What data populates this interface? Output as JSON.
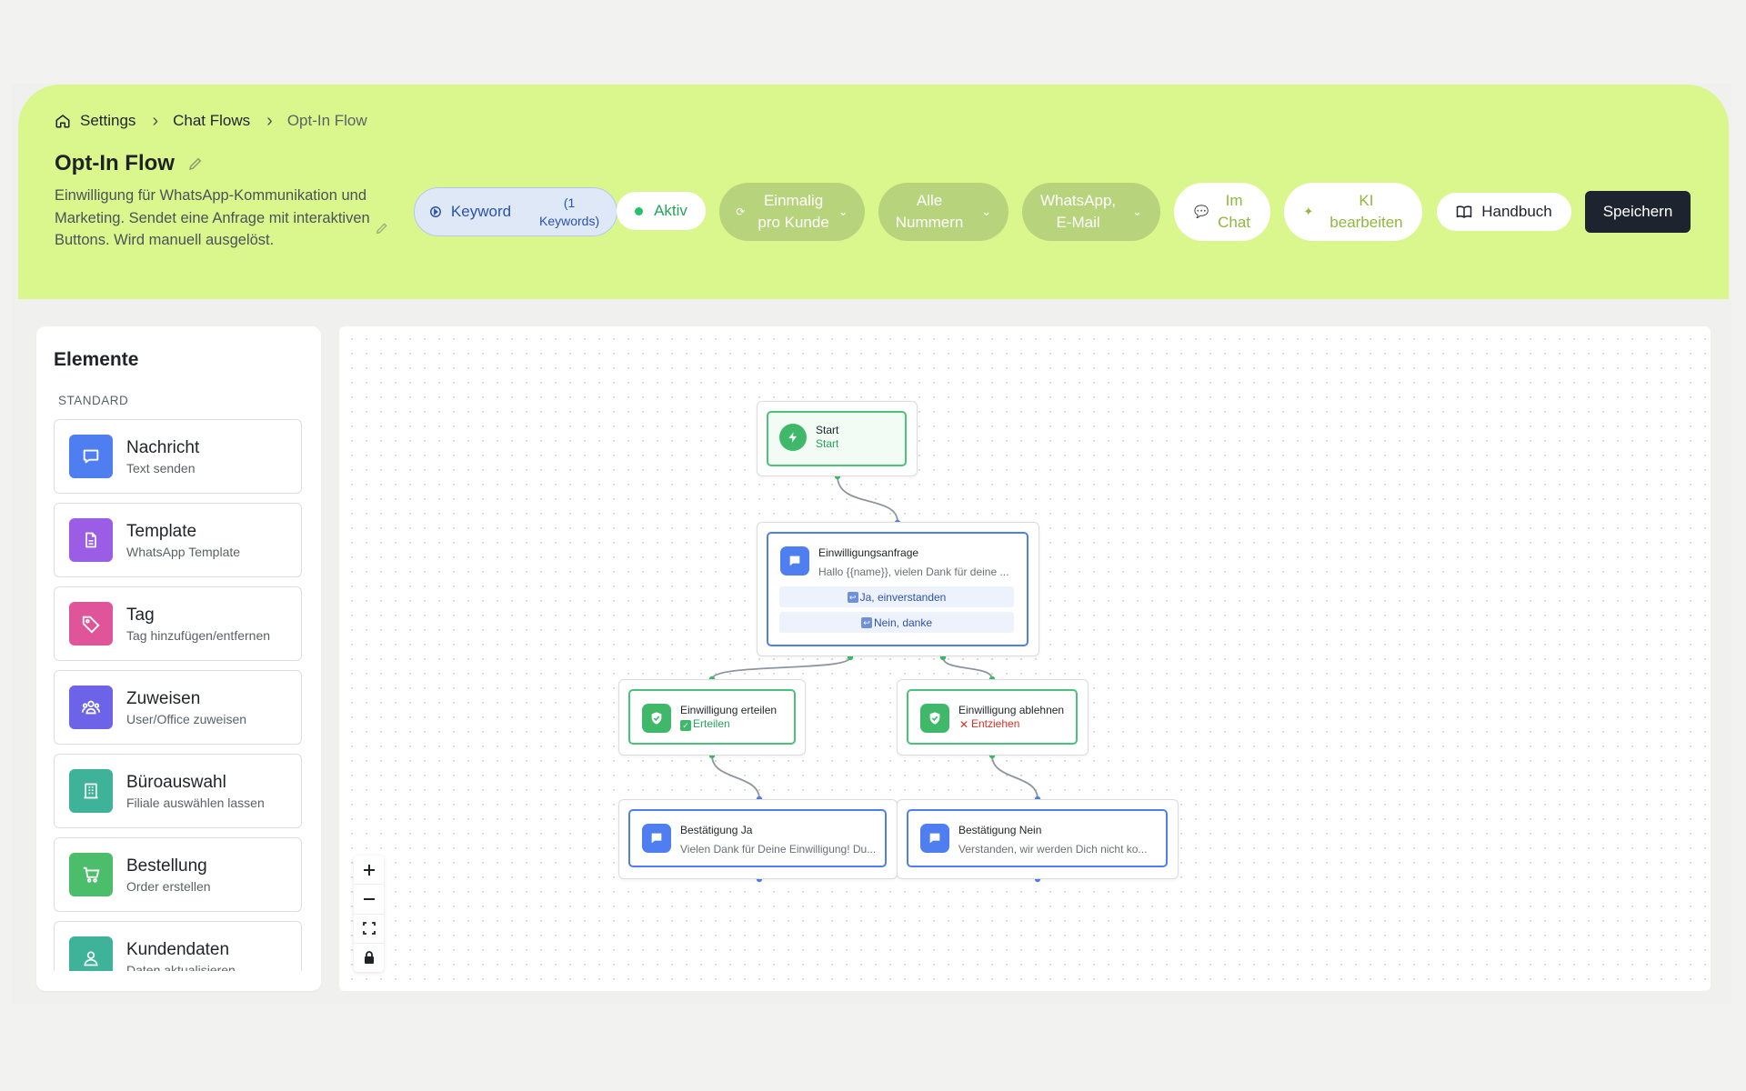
{
  "breadcrumb": {
    "items": [
      "Settings",
      "Chat Flows",
      "Opt-In Flow"
    ]
  },
  "header": {
    "title": "Opt-In Flow",
    "description": "Einwilligung für WhatsApp-Kommunikation und Marketing. Sendet eine Anfrage mit interaktiven Buttons. Wird manuell ausgelöst.",
    "trigger_label": "Keyword",
    "trigger_count": "(1 Keywords)",
    "status_label": "Aktiv",
    "frequency_line1": "Einmalig",
    "frequency_line2": "pro Kunde",
    "numbers_line1": "Alle",
    "numbers_line2": "Nummern",
    "channels_line1": "WhatsApp,",
    "channels_line2": "E-Mail",
    "chat_line1": "Im",
    "chat_line2": "Chat",
    "ai_line1": "KI",
    "ai_line2": "bearbeiten",
    "manual_label": "Handbuch",
    "save_label": "Speichern"
  },
  "sidebar": {
    "title": "Elemente",
    "section": "STANDARD",
    "items": [
      {
        "name": "Nachricht",
        "desc": "Text senden",
        "color": "#4f7ef0",
        "icon": "message-icon"
      },
      {
        "name": "Template",
        "desc": "WhatsApp Template",
        "color": "#9b5de5",
        "icon": "document-icon"
      },
      {
        "name": "Tag",
        "desc": "Tag hinzufügen/entfernen",
        "color": "#e0559a",
        "icon": "tag-icon"
      },
      {
        "name": "Zuweisen",
        "desc": "User/Office zuweisen",
        "color": "#6d63e8",
        "icon": "users-icon"
      },
      {
        "name": "Büroauswahl",
        "desc": "Filiale auswählen lassen",
        "color": "#3fb39a",
        "icon": "building-icon"
      },
      {
        "name": "Bestellung",
        "desc": "Order erstellen",
        "color": "#4cbd6a",
        "icon": "cart-icon"
      },
      {
        "name": "Kundendaten",
        "desc": "Daten aktualisieren",
        "color": "#3fb39a",
        "icon": "user-icon"
      }
    ]
  },
  "flow": {
    "start": {
      "title": "Start",
      "sub": "Start"
    },
    "request": {
      "title": "Einwilligungsanfrage",
      "sub": "Hallo {{name}}, vielen Dank für deine ...",
      "options": [
        "Ja, einverstanden",
        "Nein, danke"
      ]
    },
    "grant": {
      "title": "Einwilligung erteilen",
      "sub": "Erteilen"
    },
    "reject": {
      "title": "Einwilligung ablehnen",
      "sub": "Entziehen"
    },
    "confirm_yes": {
      "title": "Bestätigung Ja",
      "sub": "Vielen Dank für Deine Einwilligung! Du..."
    },
    "confirm_no": {
      "title": "Bestätigung Nein",
      "sub": "Verstanden, wir werden Dich nicht ko..."
    }
  },
  "colors": {
    "header_bg": "#daf78d",
    "accent_green": "#3fb969",
    "accent_blue": "#4f7ef0",
    "save_bg": "#1d2430"
  }
}
